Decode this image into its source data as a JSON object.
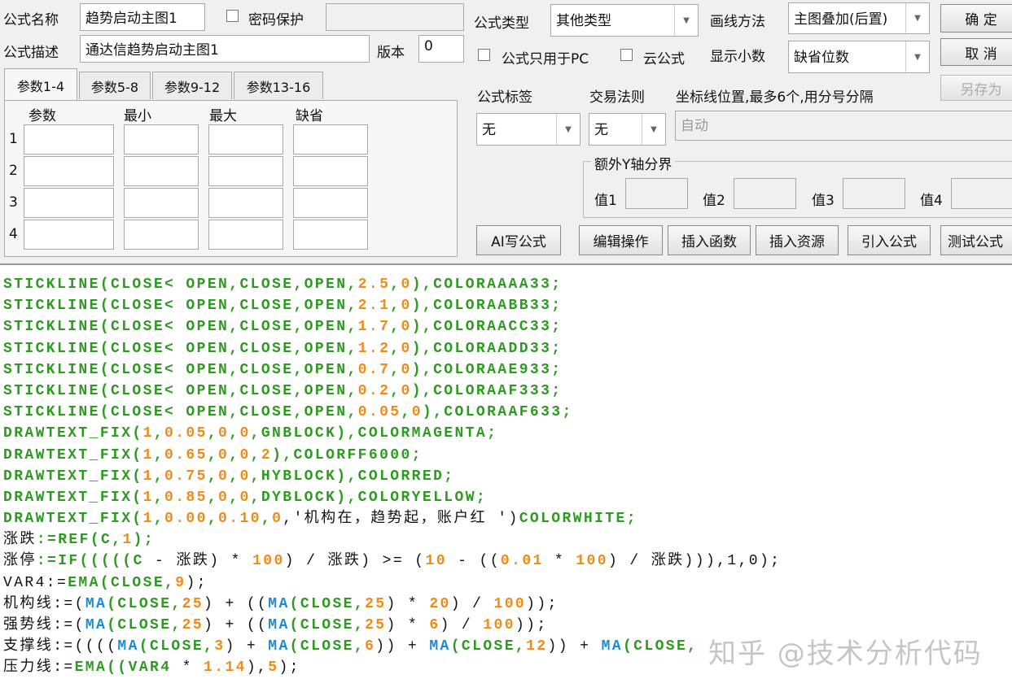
{
  "form": {
    "name_label": "公式名称",
    "name_value": "趋势启动主图1",
    "password_label": "密码保护",
    "desc_label": "公式描述",
    "desc_value": "通达信趋势启动主图1",
    "version_label": "版本",
    "version_value": "0",
    "type_label": "公式类型",
    "type_value": "其他类型",
    "draw_label": "画线方法",
    "draw_value": "主图叠加(后置)",
    "pc_only_label": "公式只用于PC",
    "cloud_label": "云公式",
    "decimals_label": "显示小数",
    "decimals_value": "缺省位数",
    "tag_label": "公式标签",
    "tag_value": "无",
    "rule_label": "交易法则",
    "rule_value": "无",
    "axis_label": "坐标线位置,最多6个,用分号分隔",
    "axis_placeholder": "自动",
    "extra_y_label": "额外Y轴分界",
    "v1": "值1",
    "v2": "值2",
    "v3": "值3",
    "v4": "值4"
  },
  "buttons": {
    "ok": "确 定",
    "cancel": "取 消",
    "save_as": "另存为",
    "ai": "AI写公式",
    "edit": "编辑操作",
    "insert_func": "插入函数",
    "insert_res": "插入资源",
    "import": "引入公式",
    "test": "测试公式"
  },
  "tabs": [
    "参数1-4",
    "参数5-8",
    "参数9-12",
    "参数13-16"
  ],
  "params": {
    "headers": [
      "参数",
      "最小",
      "最大",
      "缺省"
    ],
    "rows": [
      "1",
      "2",
      "3",
      "4"
    ]
  },
  "code": [
    [
      [
        "g",
        "STICKLINE(CLOSE< OPEN,CLOSE,OPEN,"
      ],
      [
        "o",
        "2.5"
      ],
      [
        "g",
        ","
      ],
      [
        "o",
        "0"
      ],
      [
        "g",
        "),COLORAAAA33;"
      ]
    ],
    [
      [
        "g",
        "STICKLINE(CLOSE< OPEN,CLOSE,OPEN,"
      ],
      [
        "o",
        "2.1"
      ],
      [
        "g",
        ","
      ],
      [
        "o",
        "0"
      ],
      [
        "g",
        "),COLORAABB33;"
      ]
    ],
    [
      [
        "g",
        "STICKLINE(CLOSE< OPEN,CLOSE,OPEN,"
      ],
      [
        "o",
        "1.7"
      ],
      [
        "g",
        ","
      ],
      [
        "o",
        "0"
      ],
      [
        "g",
        "),COLORAACC33;"
      ]
    ],
    [
      [
        "g",
        "STICKLINE(CLOSE< OPEN,CLOSE,OPEN,"
      ],
      [
        "o",
        "1.2"
      ],
      [
        "g",
        ","
      ],
      [
        "o",
        "0"
      ],
      [
        "g",
        "),COLORAADD33;"
      ]
    ],
    [
      [
        "g",
        "STICKLINE(CLOSE< OPEN,CLOSE,OPEN,"
      ],
      [
        "o",
        "0.7"
      ],
      [
        "g",
        ","
      ],
      [
        "o",
        "0"
      ],
      [
        "g",
        "),COLORAAE933;"
      ]
    ],
    [
      [
        "g",
        "STICKLINE(CLOSE< OPEN,CLOSE,OPEN,"
      ],
      [
        "o",
        "0.2"
      ],
      [
        "g",
        ","
      ],
      [
        "o",
        "0"
      ],
      [
        "g",
        "),COLORAAF333;"
      ]
    ],
    [
      [
        "g",
        "STICKLINE(CLOSE< OPEN,CLOSE,OPEN,"
      ],
      [
        "o",
        "0.05"
      ],
      [
        "g",
        ","
      ],
      [
        "o",
        "0"
      ],
      [
        "g",
        "),COLORAAF633;"
      ]
    ],
    [
      [
        "g",
        "DRAWTEXT_FIX("
      ],
      [
        "o",
        "1"
      ],
      [
        "g",
        ","
      ],
      [
        "o",
        "0.05"
      ],
      [
        "g",
        ","
      ],
      [
        "o",
        "0"
      ],
      [
        "g",
        ","
      ],
      [
        "o",
        "0"
      ],
      [
        "g",
        ",GNBLOCK),COLORMAGENTA;"
      ]
    ],
    [
      [
        "g",
        "DRAWTEXT_FIX("
      ],
      [
        "o",
        "1"
      ],
      [
        "g",
        ","
      ],
      [
        "o",
        "0.65"
      ],
      [
        "g",
        ","
      ],
      [
        "o",
        "0"
      ],
      [
        "g",
        ","
      ],
      [
        "o",
        "0"
      ],
      [
        "g",
        ","
      ],
      [
        "o",
        "2"
      ],
      [
        "g",
        "),COLORFF6000;"
      ]
    ],
    [
      [
        "g",
        "DRAWTEXT_FIX("
      ],
      [
        "o",
        "1"
      ],
      [
        "g",
        ","
      ],
      [
        "o",
        "0.75"
      ],
      [
        "g",
        ","
      ],
      [
        "o",
        "0"
      ],
      [
        "g",
        ","
      ],
      [
        "o",
        "0"
      ],
      [
        "g",
        ",HYBLOCK),COLORRED;"
      ]
    ],
    [
      [
        "g",
        "DRAWTEXT_FIX("
      ],
      [
        "o",
        "1"
      ],
      [
        "g",
        ","
      ],
      [
        "o",
        "0.85"
      ],
      [
        "g",
        ","
      ],
      [
        "o",
        "0"
      ],
      [
        "g",
        ","
      ],
      [
        "o",
        "0"
      ],
      [
        "g",
        ",DYBLOCK),COLORYELLOW;"
      ]
    ],
    [
      [
        "g",
        "DRAWTEXT_FIX("
      ],
      [
        "o",
        "1"
      ],
      [
        "g",
        ","
      ],
      [
        "o",
        "0.00"
      ],
      [
        "g",
        ","
      ],
      [
        "o",
        "0.10"
      ],
      [
        "g",
        ","
      ],
      [
        "o",
        "0"
      ],
      [
        "k",
        ",'机构在，趋势起，账户红 ')"
      ],
      [
        "g",
        "COLORWHITE;"
      ]
    ],
    [
      [
        "k",
        "涨跌"
      ],
      [
        "g",
        ":=REF(C,"
      ],
      [
        "o",
        "1"
      ],
      [
        "g",
        ");"
      ]
    ],
    [
      [
        "k",
        "涨停"
      ],
      [
        "g",
        ":=IF(((((C"
      ],
      [
        "k",
        " - 涨跌) * "
      ],
      [
        "o",
        "100"
      ],
      [
        "k",
        ") / 涨跌) >= ("
      ],
      [
        "o",
        "10"
      ],
      [
        "k",
        " - (("
      ],
      [
        "o",
        "0.01"
      ],
      [
        "k",
        " * "
      ],
      [
        "o",
        "100"
      ],
      [
        "k",
        ") / 涨跌))),1,0);"
      ]
    ],
    [
      [
        "k",
        "VAR4:="
      ],
      [
        "g",
        "EMA(CLOSE,"
      ],
      [
        "o",
        "9"
      ],
      [
        "k",
        ");"
      ]
    ],
    [
      [
        "k",
        "机构线:=("
      ],
      [
        "b",
        "MA"
      ],
      [
        "g",
        "(CLOSE,"
      ],
      [
        "o",
        "25"
      ],
      [
        "k",
        ") + (("
      ],
      [
        "b",
        "MA"
      ],
      [
        "g",
        "(CLOSE,"
      ],
      [
        "o",
        "25"
      ],
      [
        "k",
        ") * "
      ],
      [
        "o",
        "20"
      ],
      [
        "k",
        ") / "
      ],
      [
        "o",
        "100"
      ],
      [
        "k",
        "));"
      ]
    ],
    [
      [
        "k",
        "强势线:=("
      ],
      [
        "b",
        "MA"
      ],
      [
        "g",
        "(CLOSE,"
      ],
      [
        "o",
        "25"
      ],
      [
        "k",
        ") + (("
      ],
      [
        "b",
        "MA"
      ],
      [
        "g",
        "(CLOSE,"
      ],
      [
        "o",
        "25"
      ],
      [
        "k",
        ") * "
      ],
      [
        "o",
        "6"
      ],
      [
        "k",
        ") / "
      ],
      [
        "o",
        "100"
      ],
      [
        "k",
        "));"
      ]
    ],
    [
      [
        "k",
        "支撑线:=(((("
      ],
      [
        "b",
        "MA"
      ],
      [
        "g",
        "(CLOSE,"
      ],
      [
        "o",
        "3"
      ],
      [
        "k",
        ") + "
      ],
      [
        "b",
        "MA"
      ],
      [
        "g",
        "(CLOSE,"
      ],
      [
        "o",
        "6"
      ],
      [
        "k",
        ")) + "
      ],
      [
        "b",
        "MA"
      ],
      [
        "g",
        "(CLOSE,"
      ],
      [
        "o",
        "12"
      ],
      [
        "k",
        ")) + "
      ],
      [
        "b",
        "MA"
      ],
      [
        "g",
        "(CLOSE,"
      ]
    ],
    [
      [
        "k",
        "压力线:="
      ],
      [
        "g",
        "EMA((VAR4"
      ],
      [
        "k",
        " * "
      ],
      [
        "o",
        "1.14"
      ],
      [
        "k",
        "),"
      ],
      [
        "o",
        "5"
      ],
      [
        "k",
        ");"
      ]
    ]
  ],
  "watermark": "知乎 @技术分析代码"
}
